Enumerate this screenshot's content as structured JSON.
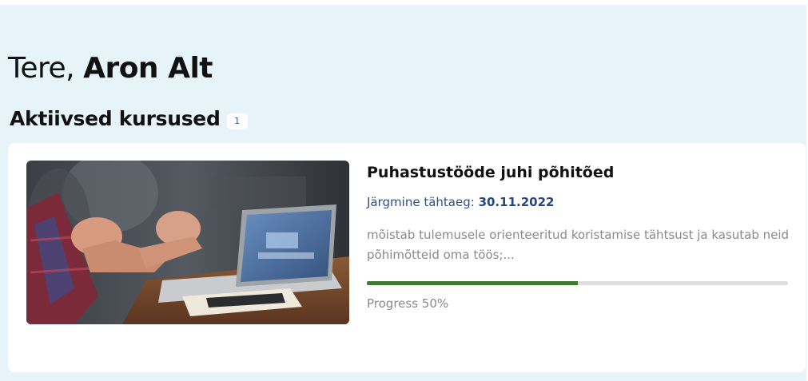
{
  "greeting": {
    "prefix": "Tere,",
    "name": "Aron Alt"
  },
  "section": {
    "title": "Aktiivsed kursused",
    "count": "1"
  },
  "courses": [
    {
      "title": "Puhastustööde juhi põhitõed",
      "deadline_label": "Järgmine tähtaeg:",
      "deadline_date": "30.11.2022",
      "description": "mõistab tulemusele orienteeritud koristamise tähtsust ja kasutab neid põhimõtteid oma töös;...",
      "progress_percent": 50,
      "progress_label": "Progress 50%",
      "image": "course-thumbnail-meeting-laptop"
    }
  ],
  "colors": {
    "background_panel": "#e6f4fa",
    "card": "#ffffff",
    "progress_fill": "#3f7a32",
    "progress_track": "#dedede",
    "deadline_text": "#2d4f86"
  }
}
